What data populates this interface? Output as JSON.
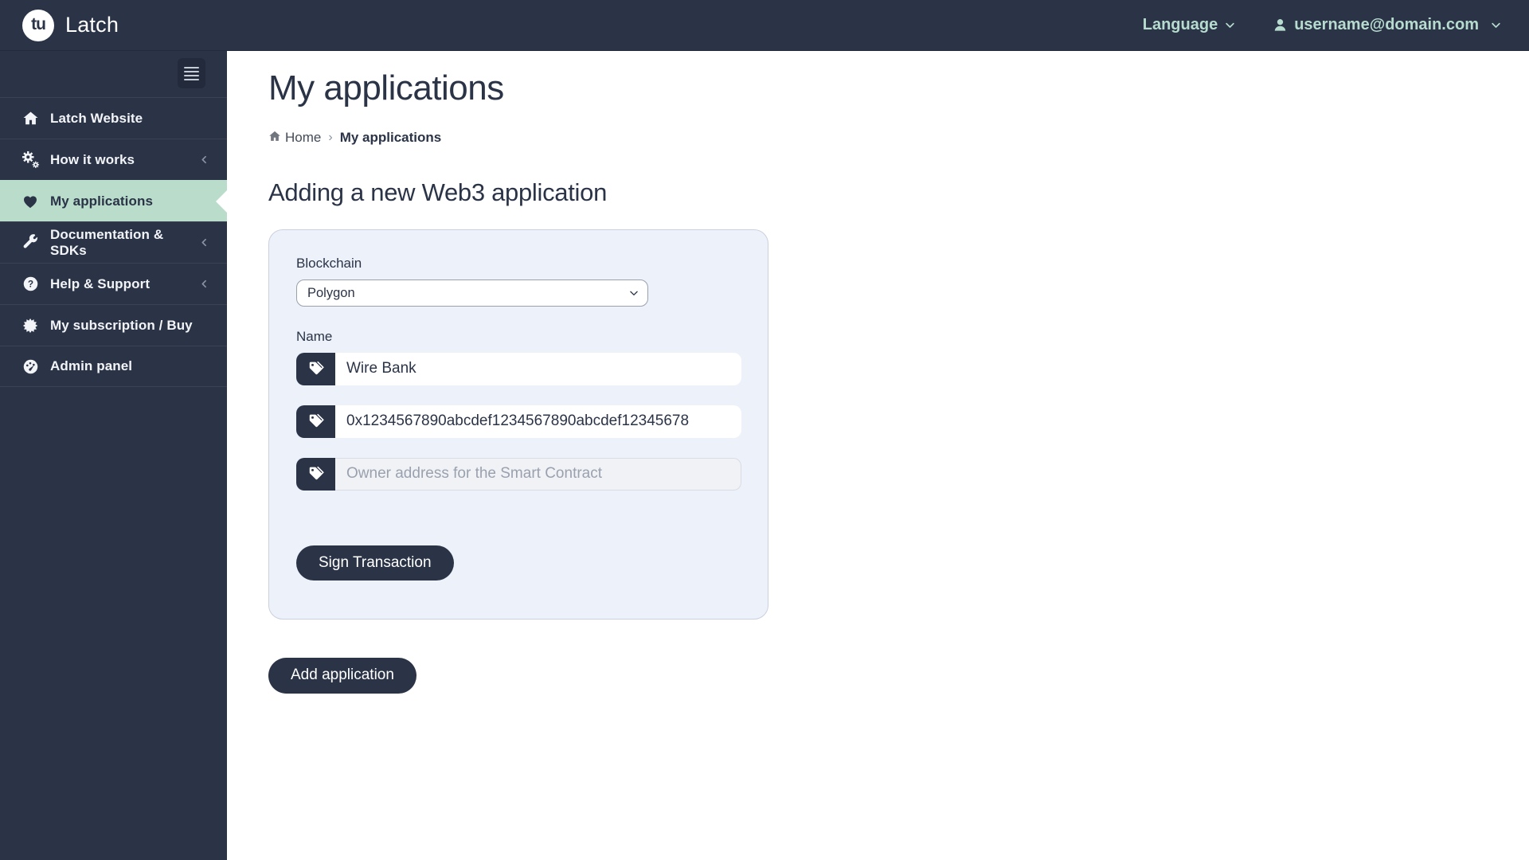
{
  "topbar": {
    "logo_monogram": "tu",
    "brand": "Latch",
    "language_label": "Language",
    "user_email": "username@domain.com"
  },
  "sidebar": {
    "items": [
      {
        "label": "Latch Website",
        "icon": "home-icon"
      },
      {
        "label": "How it works",
        "icon": "cogs-icon",
        "expandable": true
      },
      {
        "label": "My applications",
        "icon": "heart-icon",
        "active": true
      },
      {
        "label": "Documentation & SDKs",
        "icon": "wrench-icon",
        "expandable": true
      },
      {
        "label": "Help & Support",
        "icon": "question-icon",
        "expandable": true
      },
      {
        "label": "My subscription / Buy",
        "icon": "badge-icon"
      },
      {
        "label": "Admin panel",
        "icon": "dashboard-icon"
      }
    ]
  },
  "main": {
    "page_title": "My applications",
    "breadcrumb": {
      "home": "Home",
      "separator": "›",
      "current": "My applications"
    },
    "section_heading": "Adding a new Web3 application",
    "form": {
      "blockchain_label": "Blockchain",
      "blockchain_selected": "Polygon",
      "name_label": "Name",
      "name_value": "Wire Bank",
      "contract_address_value": "0x1234567890abcdef1234567890abcdef12345678",
      "owner_placeholder": "Owner address for the Smart Contract",
      "sign_button_label": "Sign Transaction"
    },
    "add_button_label": "Add application"
  },
  "colors": {
    "navy": "#2b3447",
    "active_mint": "#b9dccb",
    "topbar_text_mint": "#b7dccf",
    "card_bg": "#edf1fa",
    "card_border": "#cbd0df"
  }
}
